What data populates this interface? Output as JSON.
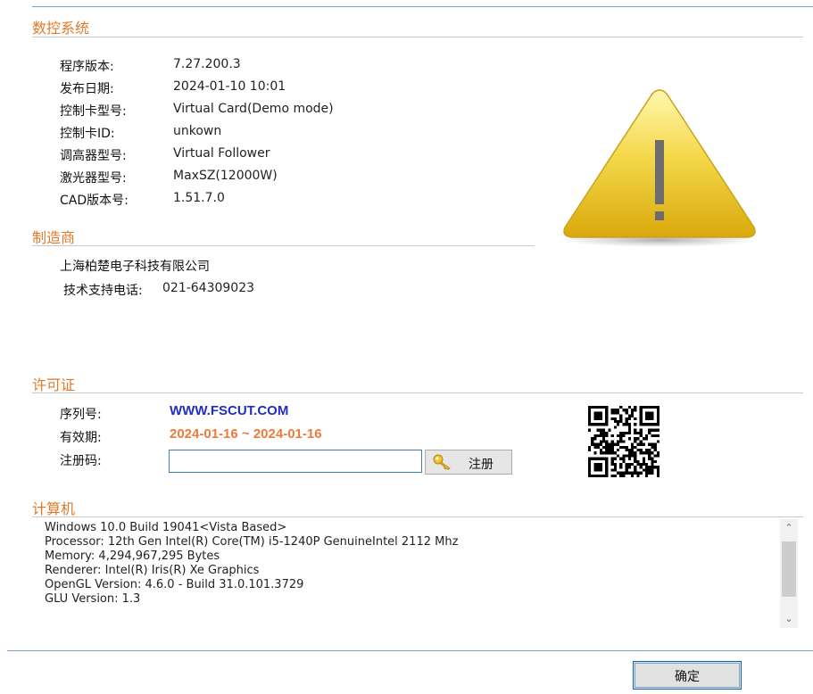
{
  "sections": {
    "cnc": "数控系统",
    "manufacturer": "制造商",
    "license": "许可证",
    "computer": "计算机"
  },
  "cnc_info": [
    {
      "label": "程序版本:",
      "value": "7.27.200.3"
    },
    {
      "label": "发布日期:",
      "value": "2024-01-10 10:01"
    },
    {
      "label": "控制卡型号:",
      "value": "Virtual Card(Demo mode)"
    },
    {
      "label": "控制卡ID:",
      "value": "unkown"
    },
    {
      "label": "调高器型号:",
      "value": "Virtual Follower"
    },
    {
      "label": "激光器型号:",
      "value": "MaxSZ(12000W)"
    },
    {
      "label": "CAD版本号:",
      "value": "1.51.7.0"
    }
  ],
  "manufacturer": {
    "company": "上海柏楚电子科技有限公司",
    "support_label": "技术支持电话:",
    "support_phone": "021-64309023"
  },
  "license": {
    "serial_label": "序列号:",
    "serial": "WWW.FSCUT.COM",
    "validity_label": "有效期:",
    "validity": "2024-01-16 ~ 2024-01-16",
    "regcode_label": "注册码:",
    "regcode_value": "",
    "register_button": "注册"
  },
  "computer_lines": [
    "Windows 10.0 Build 19041<Vista Based>",
    "Processor: 12th Gen Intel(R) Core(TM) i5-1240P GenuineIntel 2112 Mhz",
    "Memory: 4,294,967,295 Bytes",
    "Renderer: Intel(R) Iris(R) Xe Graphics",
    "OpenGL Version: 4.6.0 - Build 31.0.101.3729",
    "GLU Version: 1.3"
  ],
  "ok_button": "确定",
  "icons": {
    "warning": "warning-triangle-icon",
    "key": "key-icon",
    "qr": "qr-code",
    "scroll_up": "chevron-up-icon",
    "scroll_down": "chevron-down-icon"
  },
  "colors": {
    "section_title": "#e07a2a",
    "serial": "#1f2ec7",
    "validity": "#ee7a3a"
  }
}
